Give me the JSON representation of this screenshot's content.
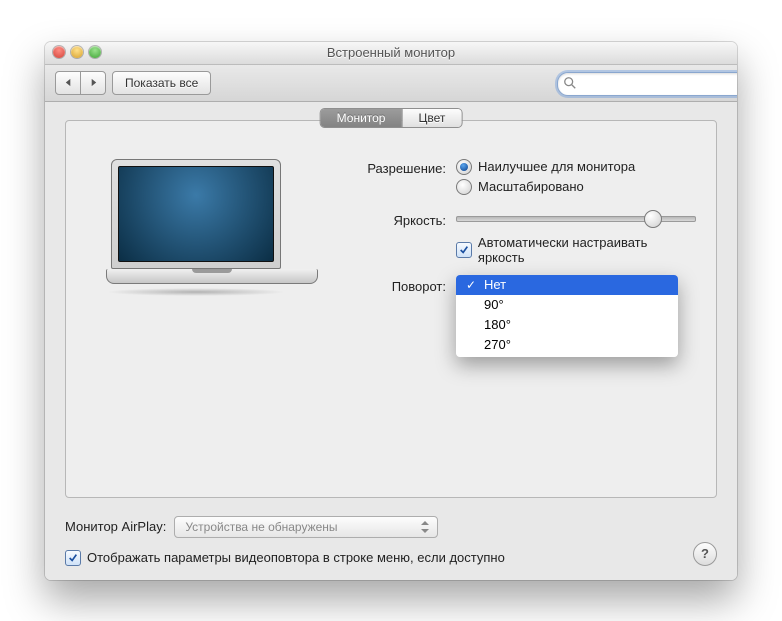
{
  "window": {
    "title": "Встроенный монитор"
  },
  "toolbar": {
    "show_all_label": "Показать все",
    "search_placeholder": ""
  },
  "tabs": {
    "monitor": "Монитор",
    "color": "Цвет",
    "active": "monitor"
  },
  "settings": {
    "resolution": {
      "label": "Разрешение:",
      "best_label": "Наилучшее для монитора",
      "scaled_label": "Масштабировано",
      "selected": "best"
    },
    "brightness": {
      "label": "Яркость:",
      "value_percent": 82,
      "auto_checkbox_label": "Автоматически настраивать яркость",
      "auto_checked": true
    },
    "rotation": {
      "label": "Поворот:",
      "options": [
        "Нет",
        "90°",
        "180°",
        "270°"
      ],
      "selected_index": 0
    }
  },
  "airplay": {
    "label": "Монитор AirPlay:",
    "select_text": "Устройства не обнаружены"
  },
  "mirror_checkbox": {
    "label": "Отображать параметры видеоповтора в строке меню, если доступно",
    "checked": true
  },
  "icons": {
    "search": "Q"
  }
}
